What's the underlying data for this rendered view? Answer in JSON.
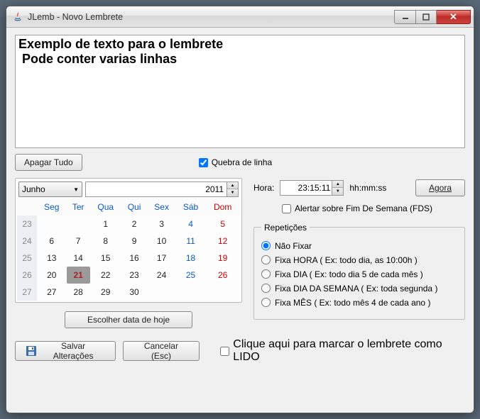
{
  "window": {
    "title": "JLemb - Novo Lembrete"
  },
  "editor": {
    "text": "Exemplo de texto para o lembrete\n Pode conter varias linhas",
    "clear_btn": "Apagar Tudo",
    "wrap_label": "Quebra de linha",
    "wrap_checked": true
  },
  "calendar": {
    "month": "Junho",
    "year": "2011",
    "day_headers": [
      "Seg",
      "Ter",
      "Qua",
      "Qui",
      "Sex",
      "Sáb",
      "Dom"
    ],
    "weeks": [
      {
        "wk": "23",
        "days": [
          "",
          "",
          "1",
          "2",
          "3",
          "4",
          "5"
        ]
      },
      {
        "wk": "24",
        "days": [
          "6",
          "7",
          "8",
          "9",
          "10",
          "11",
          "12"
        ]
      },
      {
        "wk": "25",
        "days": [
          "13",
          "14",
          "15",
          "16",
          "17",
          "18",
          "19"
        ]
      },
      {
        "wk": "26",
        "days": [
          "20",
          "21",
          "22",
          "23",
          "24",
          "25",
          "26"
        ]
      },
      {
        "wk": "27",
        "days": [
          "27",
          "28",
          "29",
          "30",
          "",
          "",
          ""
        ]
      }
    ],
    "selected_day": "21",
    "today_btn": "Escolher data de hoje"
  },
  "time": {
    "label": "Hora:",
    "value": "23:15:11",
    "format": "hh:mm:ss",
    "now_btn": "Agora"
  },
  "fds": {
    "label": "Alertar sobre Fim De Semana (FDS)",
    "checked": false
  },
  "repeat": {
    "legend": "Repetições",
    "options": [
      {
        "label": "Não Fixar",
        "selected": true
      },
      {
        "label": "Fixa HORA  ( Ex: todo dia, as 10:00h )",
        "selected": false
      },
      {
        "label": "Fixa DIA  ( Ex: todo dia 5 de cada mês )",
        "selected": false
      },
      {
        "label": "Fixa DIA DA SEMANA  ( Ex: toda segunda )",
        "selected": false
      },
      {
        "label": "Fixa MÊS  ( Ex: todo mês 4 de cada ano )",
        "selected": false
      }
    ]
  },
  "footer": {
    "save": "Salvar Alterações",
    "cancel": "Cancelar (Esc)",
    "read_label": "Clique aqui para marcar o lembrete como LIDO",
    "read_checked": false
  }
}
